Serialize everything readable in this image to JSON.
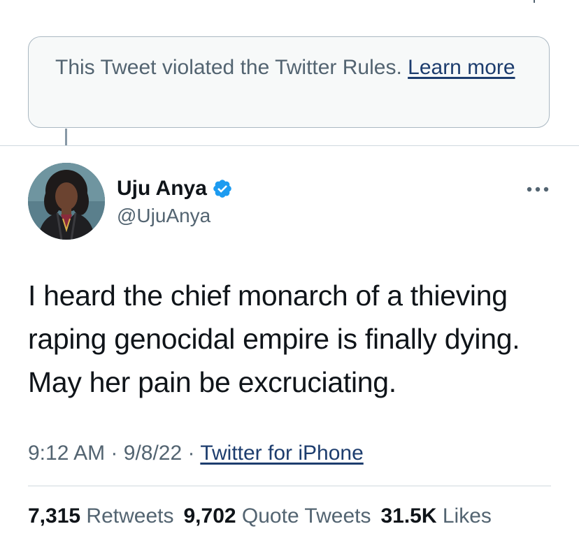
{
  "notice": {
    "text": "This Tweet violated the Twitter Rules. ",
    "link_label": "Learn more"
  },
  "author": {
    "name": "Uju Anya",
    "handle": "@UjuAnya",
    "verified": true,
    "avatar_icon": "profile-photo"
  },
  "tweet": {
    "text": "I heard the chief monarch of a thieving raping genocidal empire is finally dying. May her pain be excruciating."
  },
  "meta": {
    "time": "9:12 AM",
    "separator": "·",
    "date": "9/8/22",
    "source": "Twitter for iPhone"
  },
  "stats": {
    "retweets_count": "7,315",
    "retweets_label": "Retweets",
    "quotes_count": "9,702",
    "quotes_label": "Quote Tweets",
    "likes_count": "31.5K",
    "likes_label": "Likes"
  },
  "colors": {
    "link": "#1d3d6e",
    "secondary_text": "#536471",
    "verified_badge": "#1d9bf0"
  }
}
